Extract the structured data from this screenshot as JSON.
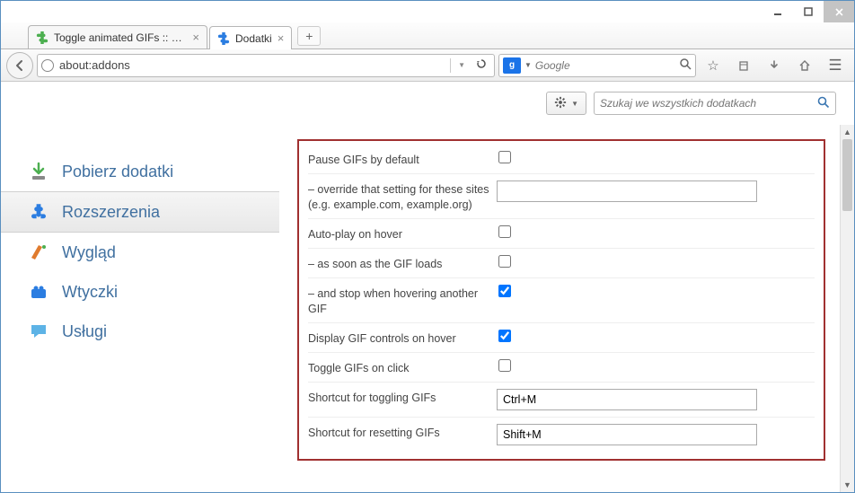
{
  "window": {
    "tabs": [
      {
        "title": "Toggle animated GIFs :: Do…",
        "icon": "puzzle-green"
      },
      {
        "title": "Dodatki",
        "icon": "puzzle-blue"
      }
    ],
    "activeTab": 1,
    "urlbar": {
      "value": "about:addons"
    },
    "searchbox": {
      "engine": "g",
      "placeholder": "Google"
    }
  },
  "addons": {
    "gearLabel": "",
    "searchPlaceholder": "Szukaj we wszystkich dodatkach",
    "sidebar": [
      {
        "key": "get",
        "label": "Pobierz dodatki"
      },
      {
        "key": "extensions",
        "label": "Rozszerzenia"
      },
      {
        "key": "appearance",
        "label": "Wygląd"
      },
      {
        "key": "plugins",
        "label": "Wtyczki"
      },
      {
        "key": "services",
        "label": "Usługi"
      }
    ],
    "activeSidebar": "extensions"
  },
  "prefs": {
    "rows": [
      {
        "label": "Pause GIFs by default",
        "type": "checkbox",
        "checked": false
      },
      {
        "label": "– override that setting for these sites (e.g. example.com, example.org)",
        "type": "text",
        "value": ""
      },
      {
        "label": "Auto-play on hover",
        "type": "checkbox",
        "checked": false
      },
      {
        "label": "– as soon as the GIF loads",
        "type": "checkbox",
        "checked": false
      },
      {
        "label": "– and stop when hovering another GIF",
        "type": "checkbox",
        "checked": true
      },
      {
        "label": "Display GIF controls on hover",
        "type": "checkbox",
        "checked": true
      },
      {
        "label": "Toggle GIFs on click",
        "type": "checkbox",
        "checked": false
      },
      {
        "label": "Shortcut for toggling GIFs",
        "type": "text",
        "value": "Ctrl+M"
      },
      {
        "label": "Shortcut for resetting GIFs",
        "type": "text",
        "value": "Shift+M"
      }
    ]
  }
}
